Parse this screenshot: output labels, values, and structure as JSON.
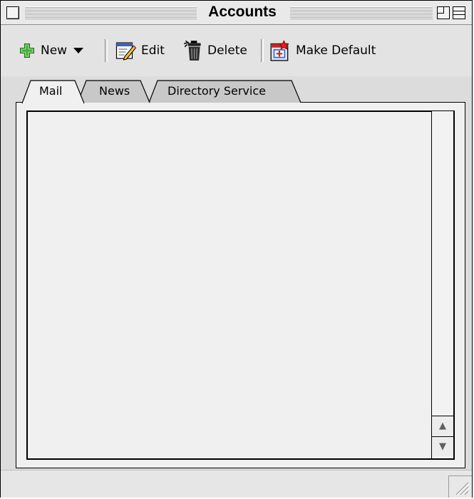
{
  "window": {
    "title": "Accounts"
  },
  "toolbar": {
    "new_label": "New",
    "edit_label": "Edit",
    "delete_label": "Delete",
    "make_default_label": "Make Default"
  },
  "tabs": [
    {
      "label": "Mail",
      "selected": true
    },
    {
      "label": "News",
      "selected": false
    },
    {
      "label": "Directory Service",
      "selected": false
    }
  ],
  "icons": {
    "new": "plus-icon",
    "new_menu": "triangle-down-icon",
    "edit": "edit-pencil-icon",
    "delete": "trash-can-icon",
    "make_default": "make-default-icon",
    "scroll_up": "arrow-up-icon",
    "scroll_down": "arrow-down-icon"
  },
  "colors": {
    "window_bg": "#dcdcdc",
    "pane_bg": "#f0f0f0",
    "selected_tab": "#f0f0f0",
    "unselected_tab": "#c8c8c8",
    "plus_green": "#2e9b2e"
  }
}
